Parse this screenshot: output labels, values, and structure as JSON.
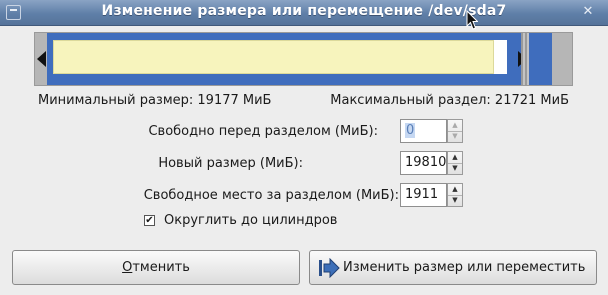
{
  "window": {
    "title": "Изменение размера или перемещение /dev/sda7",
    "close_glyph": "✕"
  },
  "partition_bar": {
    "fill_color": "#f7f4bd",
    "border_color": "#3f6dbd"
  },
  "info": {
    "min_size": "Минимальный размер: 19177 МиБ",
    "max_size": "Максимальный раздел: 21721 МиБ"
  },
  "fields": {
    "free_before": {
      "label": "Свободно перед разделом (МиБ):",
      "value": "0"
    },
    "new_size": {
      "label": "Новый размер (МиБ):",
      "value": "19810"
    },
    "free_after": {
      "label": "Свободное место за разделом (МиБ):",
      "value": "1911"
    }
  },
  "round_cylinders": {
    "label": "Округлить до цилиндров",
    "checked": true,
    "check_glyph": "✔"
  },
  "buttons": {
    "cancel_mnemonic": "О",
    "cancel_rest": "тменить",
    "apply_label": "Изменить размер или переместить"
  },
  "spin_glyphs": {
    "up": "▲",
    "down": "▼"
  }
}
